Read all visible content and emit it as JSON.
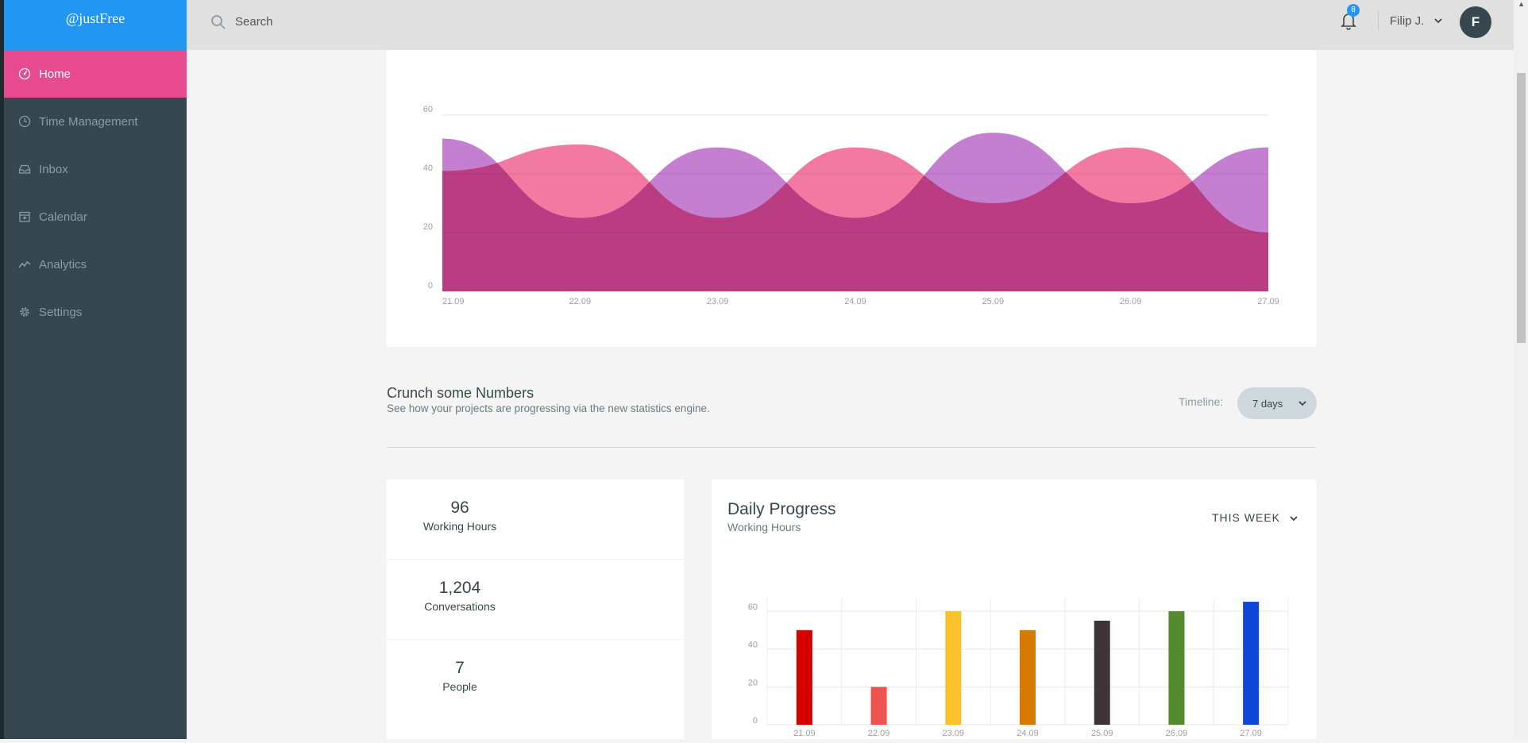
{
  "brand": "@justFree",
  "sidebar": {
    "items": [
      {
        "label": "Home",
        "icon": "dashboard-icon",
        "active": true
      },
      {
        "label": "Time Management",
        "icon": "clock-icon"
      },
      {
        "label": "Inbox",
        "icon": "inbox-icon"
      },
      {
        "label": "Calendar",
        "icon": "calendar-icon"
      },
      {
        "label": "Analytics",
        "icon": "chart-line-icon"
      },
      {
        "label": "Settings",
        "icon": "gear-icon"
      }
    ]
  },
  "header": {
    "search_placeholder": "Search",
    "notifications": "8",
    "user_name": "Filip J.",
    "avatar_initial": "F"
  },
  "section": {
    "title": "Crunch some Numbers",
    "subtitle": "See how your projects are progressing via the new statistics engine.",
    "timeline_label": "Timeline:",
    "timeline_value": "7 days"
  },
  "stats": [
    {
      "value": "96",
      "label": "Working Hours"
    },
    {
      "value": "1,204",
      "label": "Conversations"
    },
    {
      "value": "7",
      "label": "People"
    }
  ],
  "daily": {
    "title": "Daily Progress",
    "subtitle": "Working Hours",
    "filter": "THIS WEEK"
  },
  "chart_data": [
    {
      "type": "area",
      "x": [
        "21.09",
        "22.09",
        "23.09",
        "24.09",
        "25.09",
        "26.09",
        "27.09"
      ],
      "ylim": [
        0,
        60
      ],
      "yticks": [
        0,
        20,
        40,
        60
      ],
      "grid": true,
      "series": [
        {
          "color": "#f06292",
          "values": [
            41,
            50,
            25,
            49,
            30,
            49,
            20
          ]
        },
        {
          "color": "#ba68c8",
          "values": [
            52,
            25,
            49,
            25,
            54,
            30,
            49
          ]
        }
      ]
    },
    {
      "type": "bar",
      "categories": [
        "21.09",
        "22.09",
        "23.09",
        "24.09",
        "25.09",
        "26.09",
        "27.09"
      ],
      "values": [
        50,
        20,
        60,
        50,
        55,
        60,
        65
      ],
      "colors": [
        "#d50000",
        "#ef5350",
        "#fbc02d",
        "#d67a00",
        "#3e3437",
        "#558b2f",
        "#0d47d9"
      ],
      "ylim": [
        0,
        60
      ],
      "yticks": [
        0,
        20,
        40,
        60
      ],
      "grid": true
    }
  ]
}
